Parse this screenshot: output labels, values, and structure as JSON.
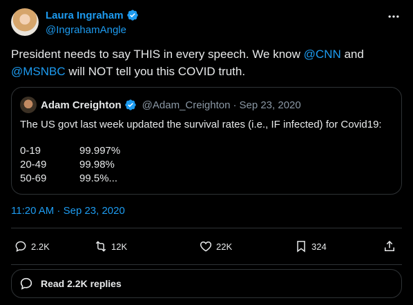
{
  "author": {
    "display_name": "Laura Ingraham",
    "handle": "@IngrahamAngle"
  },
  "tweet": {
    "text_1": "President needs to say THIS in every speech.  We know ",
    "mention_1": "@CNN",
    "text_2": " and ",
    "mention_2": "@MSNBC",
    "text_3": " will NOT tell you this COVID truth."
  },
  "quote": {
    "display_name": "Adam Creighton",
    "handle": "@Adam_Creighton",
    "separator": "·",
    "date": "Sep 23, 2020",
    "text": "The US govt last week updated the survival rates (i.e., IF infected) for Covid19:",
    "rows": [
      {
        "age": "0-19",
        "rate": "99.997%"
      },
      {
        "age": "20-49",
        "rate": "99.98%"
      },
      {
        "age": "50-69",
        "rate": "99.5%..."
      }
    ]
  },
  "timestamp": "11:20 AM · Sep 23, 2020",
  "actions": {
    "replies": "2.2K",
    "retweets": "12K",
    "likes": "22K",
    "bookmarks": "324"
  },
  "read_replies": "Read 2.2K replies",
  "colors": {
    "accent": "#1d9bf0",
    "text": "#e7e9ea",
    "muted": "#8b98a5",
    "border": "#2f3336",
    "background": "#000000"
  }
}
